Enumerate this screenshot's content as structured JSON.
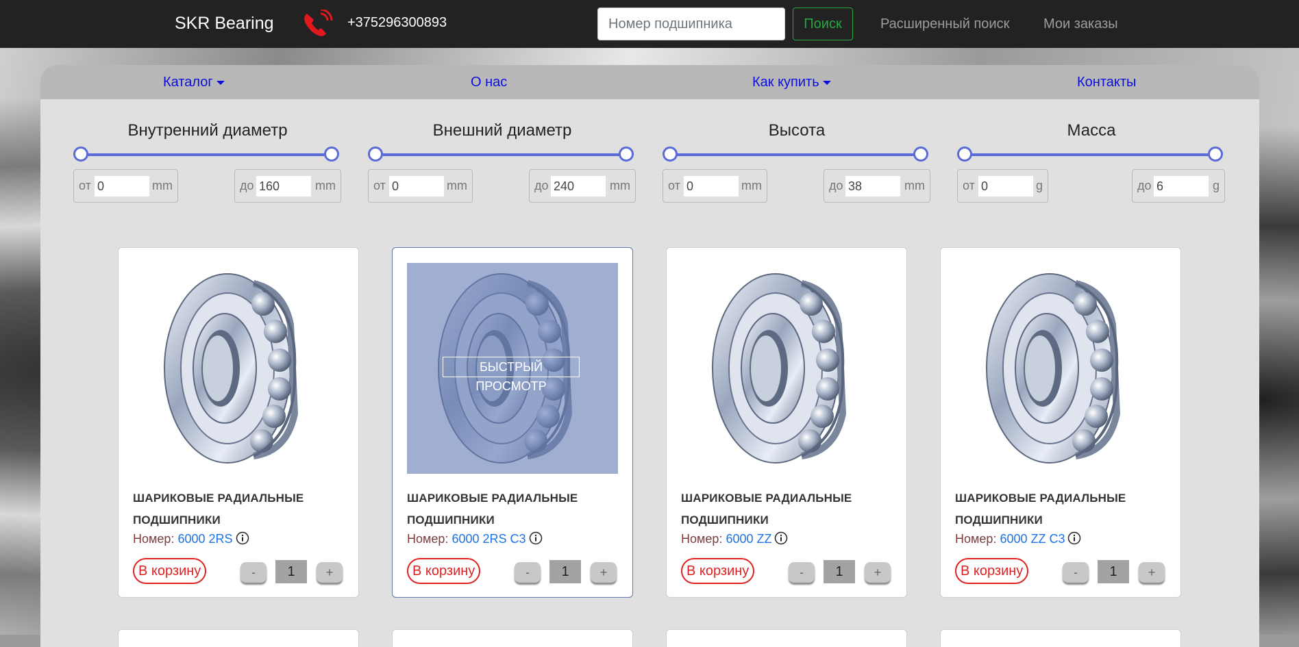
{
  "header": {
    "brand": "SKR Bearing",
    "phone_icon": "phone-icon",
    "phone": "+375296300893",
    "search_placeholder": "Номер подшипника",
    "search_button": "Поиск",
    "advanced_search": "Расширенный поиск",
    "my_orders": "Мои заказы"
  },
  "menu": {
    "catalog": "Каталог",
    "about": "О нас",
    "how_to_buy": "Как купить",
    "contacts": "Контакты"
  },
  "filters": [
    {
      "title": "Внутренний диаметр",
      "from_label": "от",
      "to_label": "до",
      "min": "0",
      "max": "160",
      "unit": "mm"
    },
    {
      "title": "Внешний диаметр",
      "from_label": "от",
      "to_label": "до",
      "min": "0",
      "max": "240",
      "unit": "mm"
    },
    {
      "title": "Высота",
      "from_label": "от",
      "to_label": "до",
      "min": "0",
      "max": "38",
      "unit": "mm"
    },
    {
      "title": "Масса",
      "from_label": "от",
      "to_label": "до",
      "min": "0",
      "max": "6",
      "unit": "g"
    }
  ],
  "quick_view": "БЫСТРЫЙ ПРОСМОТР",
  "products": [
    {
      "title": "ШАРИКОВЫЕ РАДИАЛЬНЫЕ ПОДШИПНИКИ",
      "number_label": "Номер:",
      "number": "6000 2RS",
      "cart": "В корзину",
      "minus": "-",
      "qty": "1",
      "plus": "+"
    },
    {
      "title": "ШАРИКОВЫЕ РАДИАЛЬНЫЕ ПОДШИПНИКИ",
      "number_label": "Номер:",
      "number": "6000 2RS C3",
      "cart": "В корзину",
      "minus": "-",
      "qty": "1",
      "plus": "+"
    },
    {
      "title": "ШАРИКОВЫЕ РАДИАЛЬНЫЕ ПОДШИПНИКИ",
      "number_label": "Номер:",
      "number": "6000 ZZ",
      "cart": "В корзину",
      "minus": "-",
      "qty": "1",
      "plus": "+"
    },
    {
      "title": "ШАРИКОВЫЕ РАДИАЛЬНЫЕ ПОДШИПНИКИ",
      "number_label": "Номер:",
      "number": "6000 ZZ C3",
      "cart": "В корзину",
      "minus": "-",
      "qty": "1",
      "plus": "+"
    }
  ],
  "colors": {
    "navbar": "#222222",
    "menu_link": "#0d0ddd",
    "search_button": "#28a745",
    "slider": "#5a6bd8",
    "cart": "#e02020",
    "product_number": "#1a73e8"
  }
}
